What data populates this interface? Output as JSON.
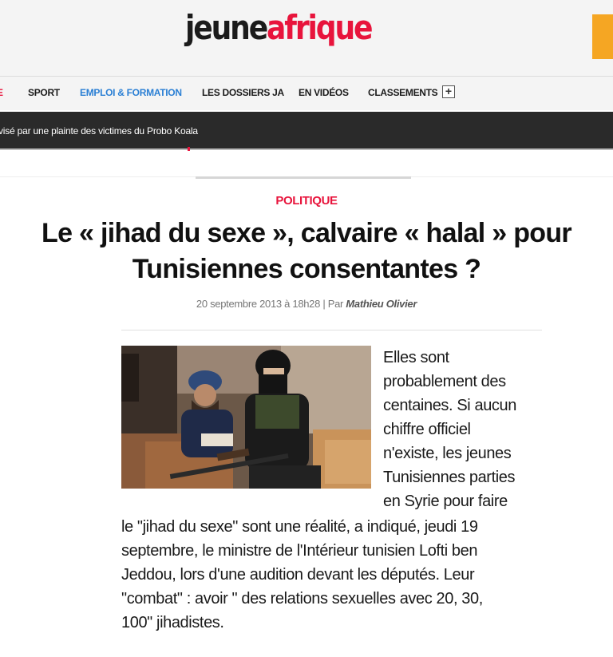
{
  "brand": {
    "logo_part1": "jeune",
    "logo_part2": "afrique",
    "accent_color": "#e8143c",
    "nav_link_color": "#2a7fd4"
  },
  "nav": {
    "cut_item": "E",
    "items": [
      "Sport",
      "Emploi & Formation",
      "Les dossiers JA",
      "En vidéos",
      "Classements"
    ],
    "more": "+"
  },
  "ticker": {
    "text": "visé par une plainte des victimes du Probo Koala"
  },
  "article": {
    "category": "Politique",
    "title_line1": "Le « jihad du sexe », calvaire « halal » pour",
    "title_line2": "Tunisiennes consentantes ?",
    "date": "20 septembre 2013 à 18h28 | Par ",
    "author": "Mathieu Olivier",
    "photo_icon": "photo-fighters",
    "body_wrapped": [
      "Elles sont",
      "probablement des",
      "centaines. Si aucun",
      "chiffre officiel",
      "n'existe, les jeunes",
      "Tunisiennes parties",
      "en Syrie pour faire"
    ],
    "body_full": [
      "le \"jihad du sexe\" sont une réalité, a indiqué, jeudi 19",
      "septembre, le ministre de l'Intérieur tunisien Lofti ben",
      "Jeddou, lors d'une audition devant les députés. Leur",
      "\"combat\" : avoir \" des relations sexuelles avec 20, 30,",
      "100\" jihadistes."
    ]
  }
}
